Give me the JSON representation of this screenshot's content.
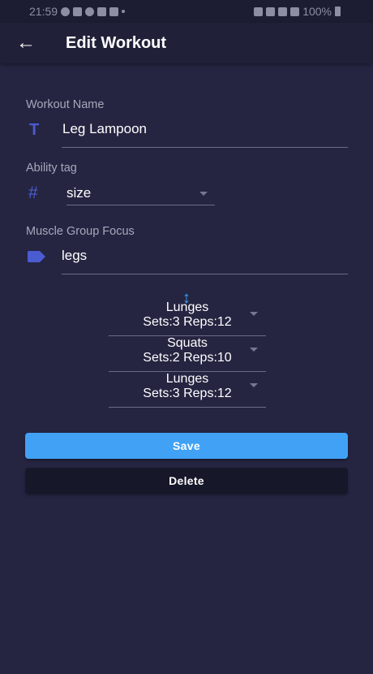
{
  "status_bar": {
    "time": "21:59",
    "battery": "100%"
  },
  "app_bar": {
    "back_icon": "arrow-left-icon",
    "title": "Edit Workout"
  },
  "form": {
    "workout_name": {
      "label": "Workout Name",
      "icon": "text-icon",
      "value": "Leg Lampoon"
    },
    "ability_tag": {
      "label": "Ability tag",
      "icon": "hash-icon",
      "value": "size"
    },
    "muscle_group": {
      "label": "Muscle Group Focus",
      "icon": "label-icon",
      "value": "legs"
    }
  },
  "exercises": {
    "reorder_icon": "reorder-icon",
    "items": [
      {
        "name": "Lunges",
        "detail": "Sets:3 Reps:12"
      },
      {
        "name": "Squats",
        "detail": "Sets:2 Reps:10"
      },
      {
        "name": "Lunges",
        "detail": "Sets:3 Reps:12"
      }
    ]
  },
  "actions": {
    "save_label": "Save",
    "delete_label": "Delete"
  },
  "colors": {
    "background": "#252542",
    "app_bar": "#202038",
    "accent": "#41a2f5",
    "icon": "#4b5bd0",
    "delete_button": "#17172a"
  }
}
